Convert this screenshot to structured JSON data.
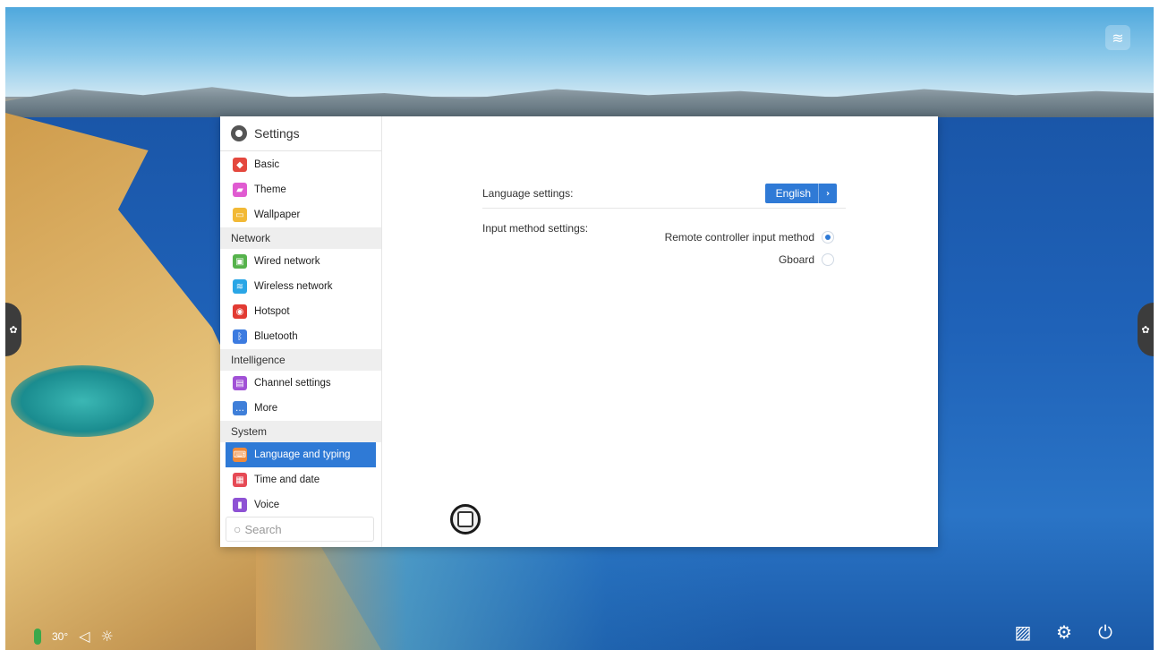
{
  "window": {
    "title": "Settings"
  },
  "sidebar": {
    "items": [
      {
        "type": "item",
        "label": "Basic",
        "icon": "basic-icon",
        "color": "#e4483e",
        "glyph": "◆"
      },
      {
        "type": "item",
        "label": "Theme",
        "icon": "theme-icon",
        "color": "#e05bd1",
        "glyph": "▰"
      },
      {
        "type": "item",
        "label": "Wallpaper",
        "icon": "wallpaper-icon",
        "color": "#f2b936",
        "glyph": "▭"
      },
      {
        "type": "section",
        "label": "Network"
      },
      {
        "type": "item",
        "label": "Wired network",
        "icon": "wired-network-icon",
        "color": "#56b34c",
        "glyph": "▣"
      },
      {
        "type": "item",
        "label": "Wireless network",
        "icon": "wifi-icon",
        "color": "#2aa6e6",
        "glyph": "≋"
      },
      {
        "type": "item",
        "label": "Hotspot",
        "icon": "hotspot-icon",
        "color": "#e23b33",
        "glyph": "◉"
      },
      {
        "type": "item",
        "label": "Bluetooth",
        "icon": "bluetooth-icon",
        "color": "#3c7be0",
        "glyph": "ᛒ"
      },
      {
        "type": "section",
        "label": "Intelligence"
      },
      {
        "type": "item",
        "label": "Channel settings",
        "icon": "channel-settings-icon",
        "color": "#a151d6",
        "glyph": "▤"
      },
      {
        "type": "item",
        "label": "More",
        "icon": "more-icon",
        "color": "#3f7fd9",
        "glyph": "…"
      },
      {
        "type": "section",
        "label": "System"
      },
      {
        "type": "item",
        "label": "Language and typing",
        "icon": "language-icon",
        "color": "#f08a3a",
        "glyph": "⌨",
        "active": true
      },
      {
        "type": "item",
        "label": "Time and date",
        "icon": "calendar-icon",
        "color": "#e64a55",
        "glyph": "▦"
      },
      {
        "type": "item",
        "label": "Voice",
        "icon": "voice-icon",
        "color": "#8e52d4",
        "glyph": "▮"
      }
    ],
    "search_placeholder": "Search"
  },
  "content": {
    "language_label": "Language settings:",
    "language_value": "English",
    "input_label": "Input method settings:",
    "input_options": [
      {
        "label": "Remote controller input method",
        "selected": true
      },
      {
        "label": "Gboard",
        "selected": false
      }
    ]
  },
  "status_bar": {
    "temperature": "30°"
  }
}
